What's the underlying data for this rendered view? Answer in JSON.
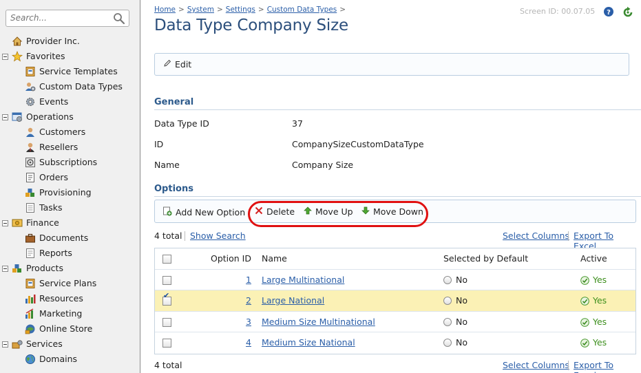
{
  "sidebar": {
    "search_placeholder": "Search...",
    "items": [
      {
        "label": "Provider Inc."
      },
      {
        "label": "Favorites"
      },
      {
        "label": "Service Templates"
      },
      {
        "label": "Custom Data Types"
      },
      {
        "label": "Events"
      },
      {
        "label": "Operations"
      },
      {
        "label": "Customers"
      },
      {
        "label": "Resellers"
      },
      {
        "label": "Subscriptions"
      },
      {
        "label": "Orders"
      },
      {
        "label": "Provisioning"
      },
      {
        "label": "Tasks"
      },
      {
        "label": "Finance"
      },
      {
        "label": "Documents"
      },
      {
        "label": "Reports"
      },
      {
        "label": "Products"
      },
      {
        "label": "Service Plans"
      },
      {
        "label": "Resources"
      },
      {
        "label": "Marketing"
      },
      {
        "label": "Online Store"
      },
      {
        "label": "Services"
      },
      {
        "label": "Domains"
      }
    ]
  },
  "header": {
    "breadcrumbs": [
      "Home",
      "System",
      "Settings",
      "Custom Data Types"
    ],
    "breadcrumb_sep": ">",
    "screen_id": "Screen ID:  00.07.05",
    "title": "Data Type Company Size"
  },
  "toolbar": {
    "edit_label": "Edit"
  },
  "general": {
    "title": "General",
    "fields": [
      {
        "label": "Data Type ID",
        "value": "37"
      },
      {
        "label": "ID",
        "value": "CompanySizeCustomDataType"
      },
      {
        "label": "Name",
        "value": "Company Size"
      }
    ]
  },
  "options": {
    "title": "Options",
    "add_label": "Add New Option",
    "delete_label": "Delete",
    "move_up_label": "Move Up",
    "move_down_label": "Move Down",
    "total_top": "4 total",
    "total_bottom": "4 total",
    "show_search": "Show Search",
    "select_columns": "Select Columns",
    "export": "Export To Excel",
    "columns": {
      "id": "Option ID",
      "name": "Name",
      "default": "Selected by Default",
      "active": "Active"
    },
    "rows": [
      {
        "id": "1",
        "name": "Large Multinational",
        "default": "No",
        "active": "Yes",
        "checked": false
      },
      {
        "id": "2",
        "name": "Large National",
        "default": "No",
        "active": "Yes",
        "checked": true
      },
      {
        "id": "3",
        "name": "Medium Size Multinational",
        "default": "No",
        "active": "Yes",
        "checked": false
      },
      {
        "id": "4",
        "name": "Medium Size National",
        "default": "No",
        "active": "Yes",
        "checked": false
      }
    ]
  },
  "colors": {
    "title": "#2c4f7c",
    "link": "#2a5ea8",
    "selected_row": "#fbf1b5",
    "highlight_oval": "#e01010",
    "active_green": "#3d8f1d"
  }
}
